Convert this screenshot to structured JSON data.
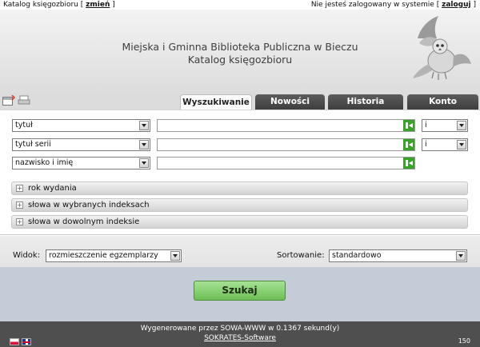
{
  "topbar": {
    "catalog_label": "Katalog księgozbioru",
    "bracket_open": "[",
    "change_link": "zmień",
    "bracket_close": "]",
    "login_status": "Nie jesteś zalogowany w systemie",
    "login_link": "zaloguj"
  },
  "header": {
    "library_name": "Miejska i Gminna Biblioteka Publiczna w Bieczu",
    "catalog_name": "Katalog księgozbioru"
  },
  "tabs": {
    "search": "Wyszukiwanie",
    "news": "Nowości",
    "history": "Historia",
    "account": "Konto"
  },
  "search_rows": [
    {
      "field": "tytuł",
      "operator": "i"
    },
    {
      "field": "tytuł serii",
      "operator": "i"
    },
    {
      "field": "nazwisko i imię"
    }
  ],
  "expand_sections": {
    "year": "rok wydania",
    "selected_indexes": "słowa w wybranych indeksach",
    "any_index": "słowa w dowolnym indeksie"
  },
  "options": {
    "view_label": "Widok:",
    "view_value": "rozmieszczenie egzemplarzy",
    "sort_label": "Sortowanie:",
    "sort_value": "standardowo"
  },
  "search_button": "Szukaj",
  "footer": {
    "generated": "Wygenerowane przez SOWA-WWW w 0.1367 sekund(y)",
    "software_link": "SOKRATES-Software",
    "counter": "150"
  },
  "colors": {
    "tab_inactive": "#4a4a4a",
    "search_button": "#82cc6b",
    "footer": "#4f4f4f"
  }
}
